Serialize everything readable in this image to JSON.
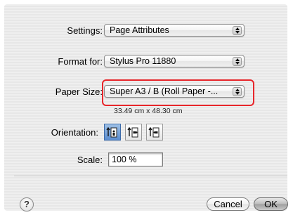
{
  "settings": {
    "label": "Settings:",
    "value": "Page Attributes"
  },
  "format_for": {
    "label": "Format for:",
    "value": "Stylus Pro 11880"
  },
  "paper_size": {
    "label": "Paper Size:",
    "value": "Super A3 / B (Roll Paper -...",
    "dimensions": "33.49 cm x 48.30 cm",
    "highlight_color": "#e8262b"
  },
  "orientation": {
    "label": "Orientation:",
    "options": [
      {
        "icon": "portrait-orientation-icon",
        "selected": true
      },
      {
        "icon": "landscape-orientation-icon",
        "selected": false
      },
      {
        "icon": "reverse-landscape-orientation-icon",
        "selected": false
      }
    ]
  },
  "scale": {
    "label": "Scale:",
    "value": "100 %"
  },
  "footer": {
    "help_glyph": "?",
    "cancel_label": "Cancel",
    "ok_label": "OK"
  }
}
